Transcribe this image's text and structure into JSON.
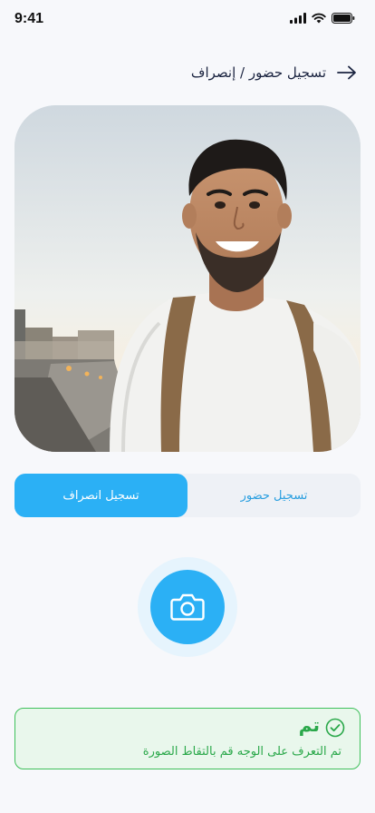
{
  "status_bar": {
    "time": "9:41",
    "icons": [
      "cellular-signal-icon",
      "wifi-icon",
      "battery-icon"
    ]
  },
  "header": {
    "title": "تسجيل حضور / إنصراف",
    "back_icon": "arrow-right-icon"
  },
  "photo": {
    "description_icon": "selfie-photo"
  },
  "toggle": {
    "options": [
      {
        "label": "تسجيل حضور",
        "active": false
      },
      {
        "label": "تسجيل انصراف",
        "active": true
      }
    ]
  },
  "camera": {
    "icon": "camera-icon"
  },
  "alert": {
    "title": "تم",
    "message": "تم التعرف على الوجه قم بالتقاط الصورة",
    "icon": "check-circle-icon"
  },
  "colors": {
    "accent": "#2bb0f5",
    "success": "#2aa84a",
    "success_bg": "#e9f7ec",
    "text_dark": "#1b2440"
  }
}
